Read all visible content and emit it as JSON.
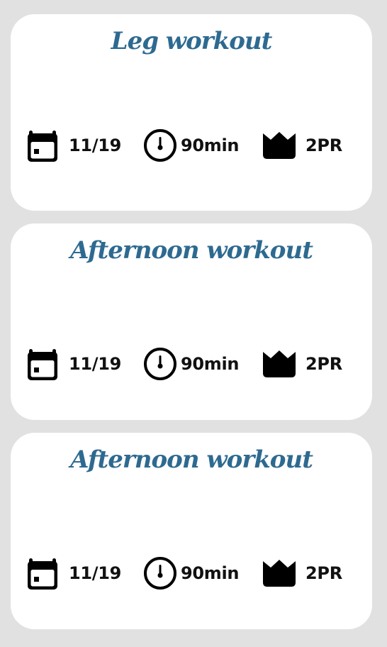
{
  "workouts": [
    {
      "title": "Leg workout",
      "date": "11/19",
      "duration": "90min",
      "prs": "2PR"
    },
    {
      "title": "Afternoon workout",
      "date": "11/19",
      "duration": "90min",
      "prs": "2PR"
    },
    {
      "title": "Afternoon workout",
      "date": "11/19",
      "duration": "90min",
      "prs": "2PR"
    }
  ],
  "icons": {
    "date": "calendar-icon",
    "duration": "stopwatch-icon",
    "prs": "crown-icon"
  },
  "colors": {
    "background": "#e1e1e1",
    "card": "#ffffff",
    "title": "#2e6a90",
    "text": "#111111"
  }
}
